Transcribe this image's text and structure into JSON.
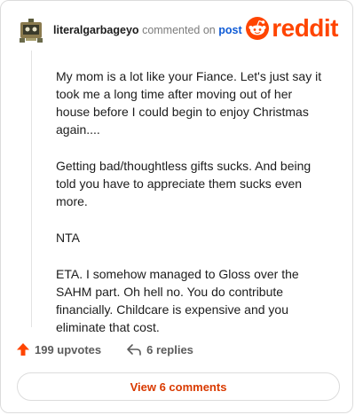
{
  "header": {
    "username": "literalgarbageyo",
    "commented_text": "commented on",
    "post_link": "post",
    "brand": "reddit"
  },
  "comment": {
    "paragraphs": [
      "My mom is a lot like your Fiance. Let's just say it took me a long time after moving out of her house before I could begin to enjoy Christmas again....",
      "Getting bad/thoughtless gifts sucks. And being told you have to appreciate them sucks even more.",
      "NTA",
      "ETA. I somehow managed to Gloss over the SAHM part. Oh hell no. You do contribute financially. Childcare is expensive and you eliminate that cost."
    ]
  },
  "actions": {
    "upvotes": "199 upvotes",
    "replies": "6 replies"
  },
  "view_button": "View 6 comments",
  "colors": {
    "brand": "#ff4500",
    "link": "#0f5bd6",
    "view_button_text": "#d93a00"
  },
  "icons": {
    "upvote": "upvote-arrow-icon",
    "reply": "reply-arrow-icon",
    "logo": "reddit-snoo-icon"
  }
}
